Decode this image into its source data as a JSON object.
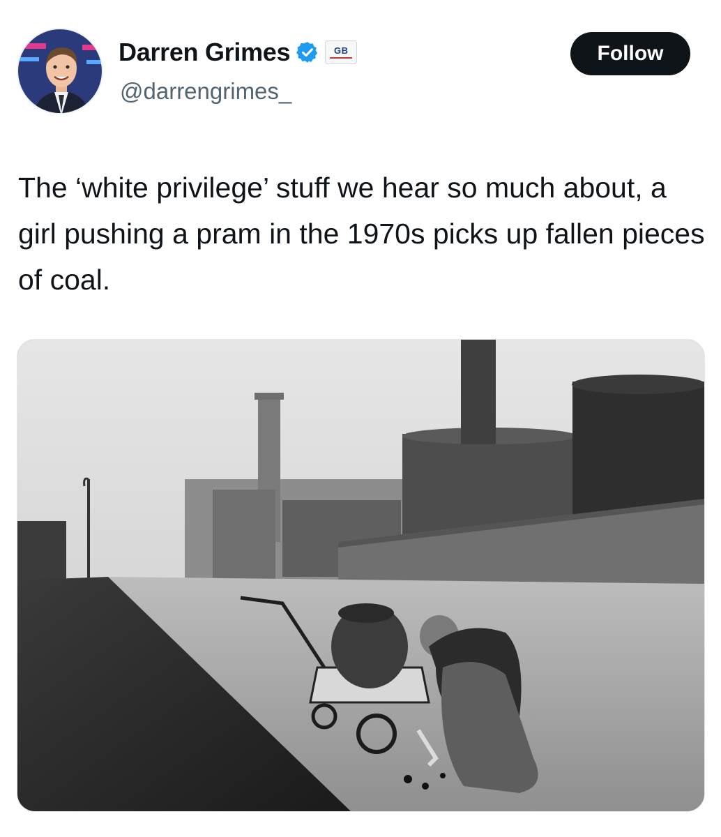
{
  "author": {
    "name": "Darren Grimes",
    "handle": "@darrengrimes_",
    "verified_icon": "verified-badge-icon",
    "affiliation_badge": "GB",
    "avatar": "avatar-photo"
  },
  "actions": {
    "follow_label": "Follow"
  },
  "tweet": {
    "text": "The ‘white privilege’ stuff we hear so much about, a girl pushing a pram in the 1970s picks up fallen pieces of coal."
  },
  "media": {
    "kind": "black-and-white photograph"
  },
  "colors": {
    "accent_blue": "#1d9bf0",
    "follow_bg": "#0f1419",
    "handle_gray": "#536471"
  }
}
